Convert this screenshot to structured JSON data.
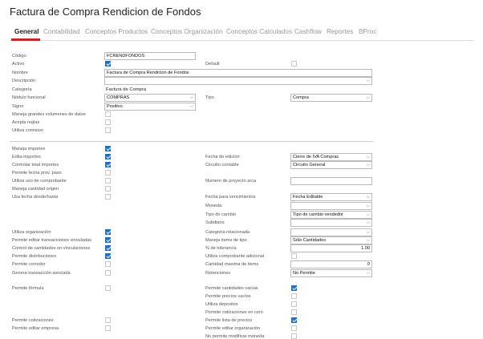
{
  "title": "Factura de Compra Rendicion de Fondos",
  "tabs": [
    "General",
    "Contabilidad",
    "Conceptos Productos",
    "Conceptos Organización",
    "Conceptos Calculados",
    "Cashflow",
    "Reportes",
    "BProc"
  ],
  "fields": {
    "codigo": {
      "label": "Código",
      "value": "FCRENDFONDOS"
    },
    "activo": {
      "label": "Activo",
      "checked": true
    },
    "default": {
      "label": "Default",
      "checked": false
    },
    "nombre": {
      "label": "Nombre",
      "value": "Factura de Compra Rendicion de Fondos"
    },
    "descripcion": {
      "label": "Descripción",
      "value": ""
    },
    "categoria": {
      "label": "Categoría",
      "value": "Factura de Compra"
    },
    "nodo_funcional": {
      "label": "Nódulo funcional",
      "value": "COMPRAS"
    },
    "tipo": {
      "label": "Tipo",
      "value": "Compra"
    },
    "signo": {
      "label": "Signo",
      "value": "Positivo."
    },
    "maneja_grandes": {
      "label": "Maneja grandes volumenes de datos",
      "checked": false
    },
    "acepta_reglas": {
      "label": "Acepta reglas",
      "checked": false
    },
    "utiliza_comision": {
      "label": "Utiliza comision",
      "checked": false
    },
    "maneja_importes": {
      "label": "Maneja importes",
      "checked": true
    },
    "edita_importes": {
      "label": "Edita importes",
      "checked": true
    },
    "controlar_total": {
      "label": "Controlar total importes",
      "checked": true
    },
    "permite_fecha": {
      "label": "Permite fecha prov. paso",
      "checked": false
    },
    "utiliza_uso": {
      "label": "Utiliza uso de comprobante",
      "checked": false
    },
    "maneja_cantidad": {
      "label": "Maneja cantidad origen",
      "checked": false
    },
    "usa_fecha": {
      "label": "Usa fecha desde/hasta",
      "checked": false
    },
    "fecha_edicion": {
      "label": "Fecha de edición",
      "value": "Cierre de IVA Compras"
    },
    "circuito_contable": {
      "label": "Circuito contable",
      "value": "Circuito General"
    },
    "numero_proyecto": {
      "label": "Numero de proyecto arca",
      "value": ""
    },
    "fecha_vencimiento": {
      "label": "Fecha para vencimientos",
      "value": "Fecha Editable"
    },
    "moneda": {
      "label": "Moneda",
      "value": ""
    },
    "tipo_cambio": {
      "label": "Tipo de cambio",
      "value": "Tipo de cambio vendedor"
    },
    "subdiario": {
      "label": "Subdiario",
      "value": ""
    },
    "utiliza_org": {
      "label": "Utiliza organización",
      "checked": true
    },
    "permite_editar_trans": {
      "label": "Permite editar transacciones vinculadas",
      "checked": true
    },
    "control_cantidades": {
      "label": "Control de cantidades en vinculaciones",
      "checked": true
    },
    "permite_distribuciones": {
      "label": "Permite distribuciones",
      "checked": true
    },
    "permite_corredor": {
      "label": "Permite corredor",
      "checked": false
    },
    "genera_transaccion": {
      "label": "Genera transacción asociada",
      "checked": false
    },
    "categoria_relacionada": {
      "label": "Categoría relacionada",
      "value": ""
    },
    "maneja_items": {
      "label": "Maneja items de tipo",
      "value": "Sólo Cantidades"
    },
    "tolerancia": {
      "label": "% de tolerancia",
      "value": "1.00"
    },
    "utiliza_comp_adicional": {
      "label": "Utiliza comprobante adicional",
      "checked": false
    },
    "cantidad_maxima": {
      "label": "Cantidad maxima de items",
      "value": "0"
    },
    "retenciones": {
      "label": "Retenciones",
      "value": "No Permite"
    },
    "permite_formula": {
      "label": "Permite fórmula",
      "checked": false
    },
    "permite_cotizaciones": {
      "label": "Permite cotizaciones",
      "checked": false
    },
    "permite_editar_empresa": {
      "label": "Permite editar empresa",
      "checked": false
    },
    "permite_cant_vacias": {
      "label": "Permite cantidades vacías",
      "checked": true
    },
    "permite_precios_vacios": {
      "label": "Permite precios vacíos",
      "checked": false
    },
    "utiliza_depositos": {
      "label": "Utiliza depositos",
      "checked": false
    },
    "permite_cotiz_cero": {
      "label": "Permite cotizaciones en cero",
      "checked": false
    },
    "permite_lista_precios": {
      "label": "Permite lista de precios",
      "checked": true
    },
    "permite_editar_org": {
      "label": "Permite editar organización",
      "checked": false
    },
    "no_permite_modificar_moneda": {
      "label": "No permite modificar moneda",
      "checked": false
    }
  },
  "icons": {
    "chevron": "chevron-down-icon",
    "check": "checkmark-icon"
  },
  "colors": {
    "accent": "#c62828",
    "checkbox": "#1e73c8"
  }
}
